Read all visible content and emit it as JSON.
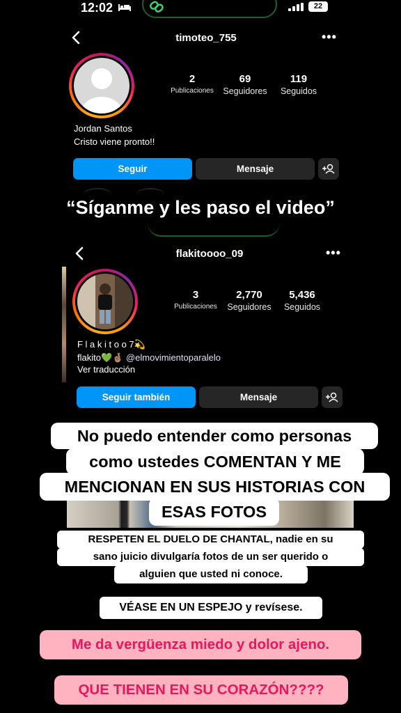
{
  "status_bar": {
    "time": "12:02",
    "battery": "22",
    "bed_icon": "bed-icon",
    "link_icon": "link-icon",
    "signal_icon": "signal-icon"
  },
  "profile1": {
    "username": "timoteo_755",
    "more": "•••",
    "stats": [
      {
        "value": "2",
        "label": "Publicaciones"
      },
      {
        "value": "69",
        "label": "Seguidores"
      },
      {
        "value": "119",
        "label": "Seguidos"
      }
    ],
    "name": "Jordan Santos",
    "bio": "Cristo viene pronto!!",
    "follow_label": "Seguir",
    "message_label": "Mensaje"
  },
  "headline": "“Síganme y les paso el video”",
  "profile2": {
    "username": "flakitoooo_09",
    "more": "•••",
    "stats": [
      {
        "value": "3",
        "label": "Publicaciones"
      },
      {
        "value": "2,770",
        "label": "Seguidores"
      },
      {
        "value": "5,436",
        "label": "Seguidos"
      }
    ],
    "name": "F l a k i t o o 7💫",
    "bio_prefix": "flakito💚🤞🏽",
    "bio_mention": "@elmovimientoparalelo",
    "translate": "Ver traducción",
    "follow_label": "Seguir también",
    "message_label": "Mensaje"
  },
  "captions": {
    "main_lines": [
      "No puedo entender como personas",
      "como ustedes COMENTAN Y ME",
      "MENCIONAN EN SUS HISTORIAS CON",
      "ESAS FOTOS"
    ],
    "respeten_lines": [
      "RESPETEN EL DUELO DE CHANTAL, nadie en su",
      "sano juicio divulgaría fotos de un ser querido o",
      "alguien que usted ni conoce."
    ],
    "espejo": "VÉASE EN UN ESPEJO y revísese.",
    "verguenza": "Me da vergüenza miedo y dolor ajeno.",
    "corazon": "QUE TIENEN EN SU CORAZÓN????"
  },
  "colors": {
    "follow_blue": "#0095f6",
    "dark_button": "#262626",
    "pink_caption": "#ffb3c1",
    "pink_text": "#e8175d",
    "mention_blue": "#a8c8ff"
  }
}
